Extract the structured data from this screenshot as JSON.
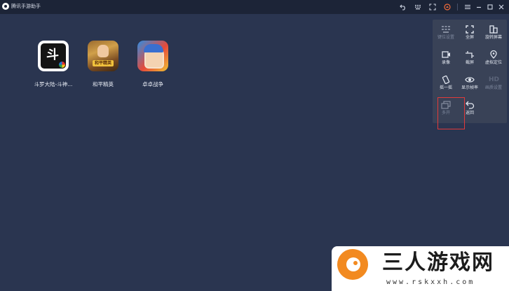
{
  "titlebar": {
    "app_title": "腾讯手游助手",
    "buttons": [
      {
        "name": "back-icon"
      },
      {
        "name": "keyboard-icon"
      },
      {
        "name": "fullscreen-icon"
      },
      {
        "name": "bell-icon"
      },
      {
        "name": "menu-icon"
      },
      {
        "name": "minimize-icon"
      },
      {
        "name": "maximize-icon"
      },
      {
        "name": "close-icon"
      }
    ]
  },
  "desktop": {
    "games": [
      {
        "label": "斗罗大陆-斗神...",
        "icon": "douluo-dalu-icon"
      },
      {
        "label": "和平精英",
        "icon": "heping-jingying-icon",
        "badge": "和平精英"
      },
      {
        "label": "卓卓战争",
        "icon": "zhuozhuo-war-icon"
      }
    ]
  },
  "side_panel": {
    "items": [
      {
        "label": "键位设置",
        "icon": "keymap-icon",
        "enabled": false
      },
      {
        "label": "全屏",
        "icon": "fullscreen-icon",
        "enabled": true
      },
      {
        "label": "旋转屏幕",
        "icon": "rotate-screen-icon",
        "enabled": true
      },
      {
        "label": "录像",
        "icon": "video-record-icon",
        "enabled": true
      },
      {
        "label": "截屏",
        "icon": "screenshot-icon",
        "enabled": true
      },
      {
        "label": "虚拟定位",
        "icon": "location-icon",
        "enabled": true
      },
      {
        "label": "摇一摇",
        "icon": "shake-icon",
        "enabled": true
      },
      {
        "label": "显示帧率",
        "icon": "fps-icon",
        "enabled": true
      },
      {
        "label": "画质设置",
        "icon": "hd-icon",
        "enabled": false,
        "glyph": "HD"
      },
      {
        "label": "多开",
        "icon": "multi-instance-icon",
        "enabled": false
      },
      {
        "label": "返回",
        "icon": "return-icon",
        "enabled": true
      }
    ]
  },
  "watermark": {
    "name": "三人游戏网",
    "url": "www.rskxxh.com"
  },
  "colors": {
    "background": "#2a3550",
    "titlebar": "#1c2437",
    "panel": "#394257",
    "highlight": "#e23a3a",
    "watermark_orange": "#f28a20"
  }
}
